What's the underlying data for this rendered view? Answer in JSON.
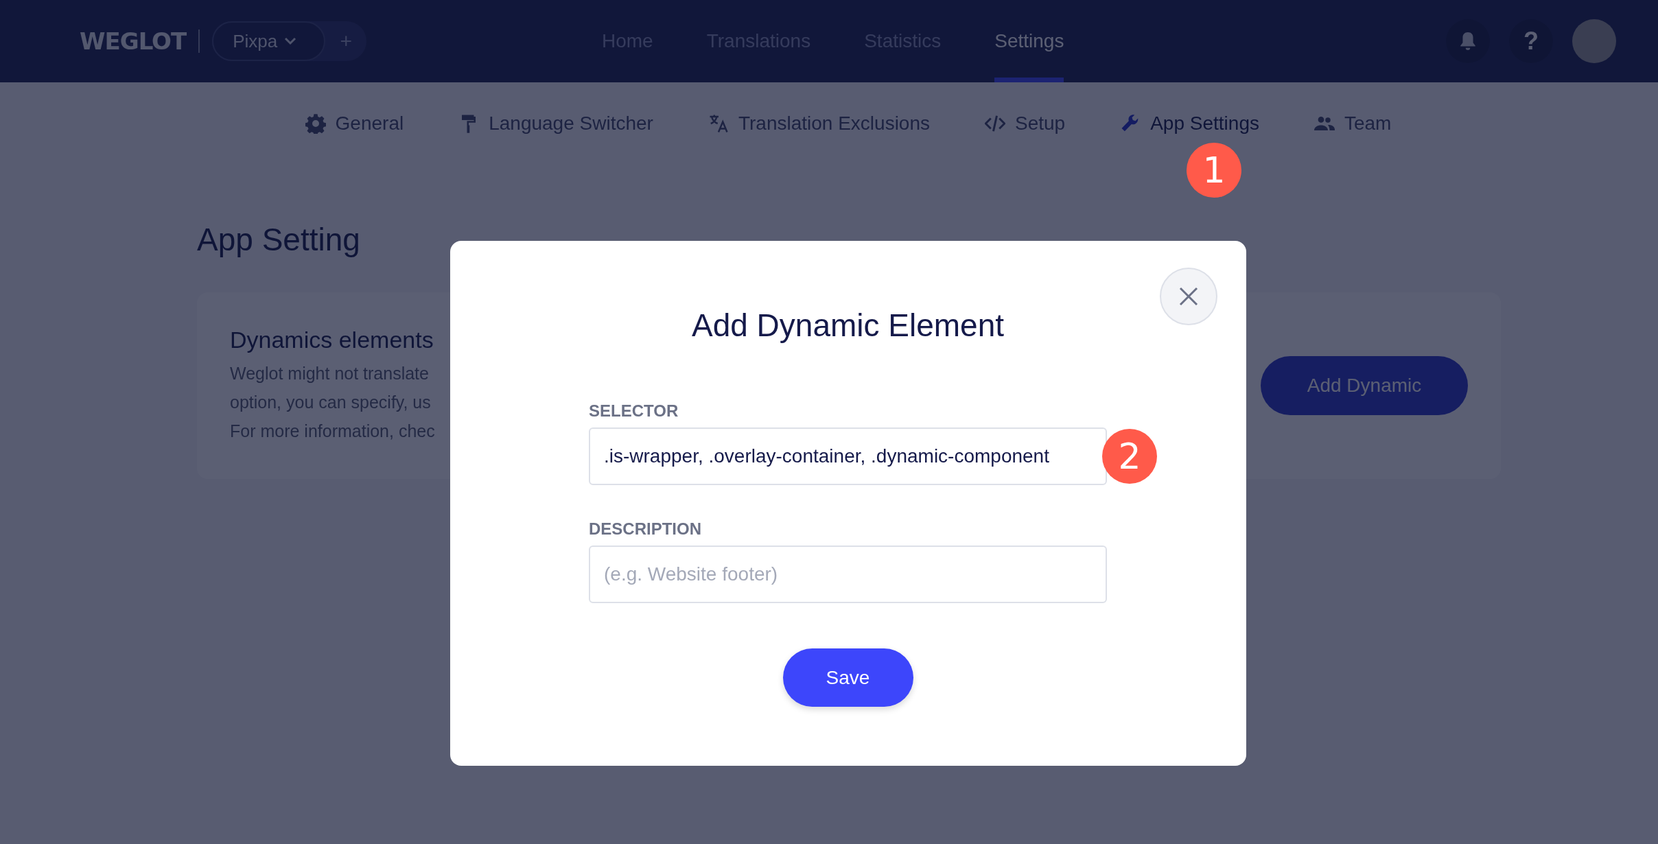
{
  "topbar": {
    "logo": "WEGLOT",
    "project": "Pixpa",
    "add_button": "+",
    "nav": [
      {
        "label": "Home",
        "selected": false
      },
      {
        "label": "Translations",
        "selected": false
      },
      {
        "label": "Statistics",
        "selected": false
      },
      {
        "label": "Settings",
        "selected": true
      }
    ],
    "help": "?"
  },
  "subnav": [
    {
      "kind": "gear",
      "label": "General",
      "selected": false
    },
    {
      "kind": "roller",
      "label": "Language Switcher",
      "selected": false
    },
    {
      "kind": "translate",
      "label": "Translation Exclusions",
      "selected": false
    },
    {
      "kind": "code",
      "label": "Setup",
      "selected": false
    },
    {
      "kind": "wrench",
      "label": "App Settings",
      "selected": true
    },
    {
      "kind": "people",
      "label": "Team",
      "selected": false
    }
  ],
  "callouts": [
    "1",
    "2"
  ],
  "page_title": "App Setting",
  "card": {
    "title": "Dynamics elements",
    "lines": [
      "Weglot might not translate",
      "option, you can specify, us",
      "For more information, chec"
    ],
    "button": "Add Dynamic"
  },
  "modal": {
    "title": "Add Dynamic Element",
    "fields": [
      {
        "label": "SELECTOR",
        "value": ".is-wrapper, .overlay-container, .dynamic-component"
      },
      {
        "label": "DESCRIPTION",
        "placeholder": "(e.g. Website footer)"
      }
    ],
    "button": "Save"
  }
}
